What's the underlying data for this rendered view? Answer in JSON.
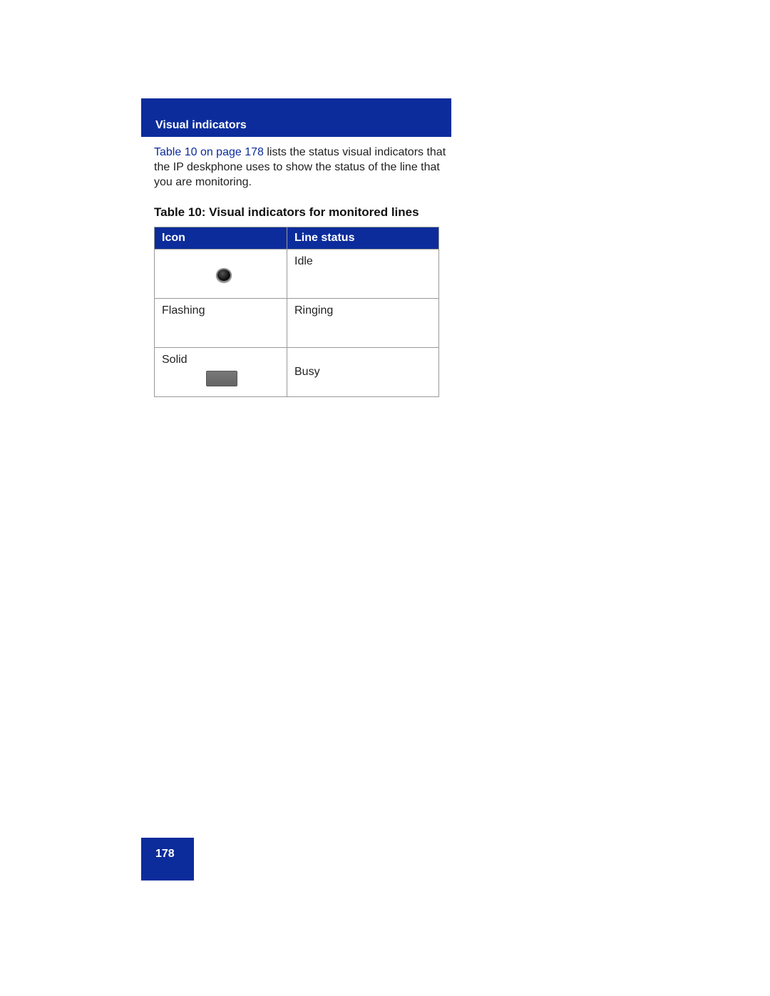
{
  "header": {
    "title": "Visual indicators"
  },
  "body": {
    "link_text": "Table 10 on page 178",
    "text_after_link": " lists the status visual indicators that the IP deskphone uses to show the status of the line that you are monitoring."
  },
  "table_caption": "Table 10: Visual indicators for monitored lines",
  "table": {
    "headers": [
      "Icon",
      "Line status"
    ],
    "rows": [
      {
        "icon_label": "",
        "icon_type": "circle",
        "status": "Idle"
      },
      {
        "icon_label": "Flashing",
        "icon_type": "",
        "status": "Ringing"
      },
      {
        "icon_label": "Solid",
        "icon_type": "rect",
        "status": "Busy"
      }
    ]
  },
  "page_number": "178"
}
